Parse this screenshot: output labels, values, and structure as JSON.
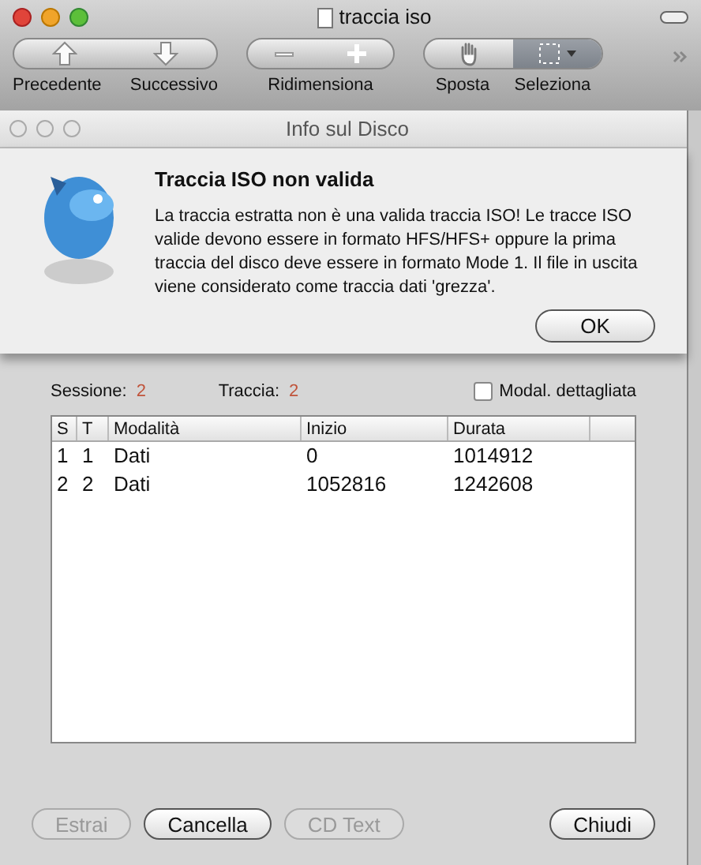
{
  "window": {
    "title": "traccia iso"
  },
  "toolbar": [
    {
      "label": "Precedente",
      "kind": "up"
    },
    {
      "label": "Successivo",
      "kind": "down"
    },
    {
      "label": "Ridimensiona"
    },
    {
      "label": "Sposta",
      "kind": "hand"
    },
    {
      "label": "Seleziona",
      "kind": "select",
      "selected": true
    }
  ],
  "dialog": {
    "title": "Info sul Disco"
  },
  "alert": {
    "title": "Traccia ISO non valida",
    "message": "La traccia estratta non è una valida traccia ISO! Le tracce ISO valide devono essere in formato HFS/HFS+ oppure la prima traccia del disco deve essere in formato Mode 1. Il file in uscita viene considerato come traccia dati 'grezza'.",
    "button": "OK"
  },
  "summary": {
    "session_label": "Sessione:",
    "session_value": "2",
    "track_label": "Traccia:",
    "track_value": "2",
    "detail_checkbox": {
      "label": "Modal. dettagliata",
      "checked": false
    }
  },
  "table": {
    "columns": [
      "S",
      "T",
      "Modalità",
      "Inizio",
      "Durata"
    ],
    "rows": [
      [
        "1",
        "1",
        "Dati",
        "0",
        "1014912"
      ],
      [
        "2",
        "2",
        "Dati",
        "1052816",
        "1242608"
      ]
    ]
  },
  "buttons": [
    {
      "label": "Estrai",
      "disabled": true
    },
    {
      "label": "Cancella",
      "disabled": false
    },
    {
      "label": "CD Text",
      "disabled": true
    },
    {
      "label": "Chiudi",
      "disabled": false
    }
  ]
}
